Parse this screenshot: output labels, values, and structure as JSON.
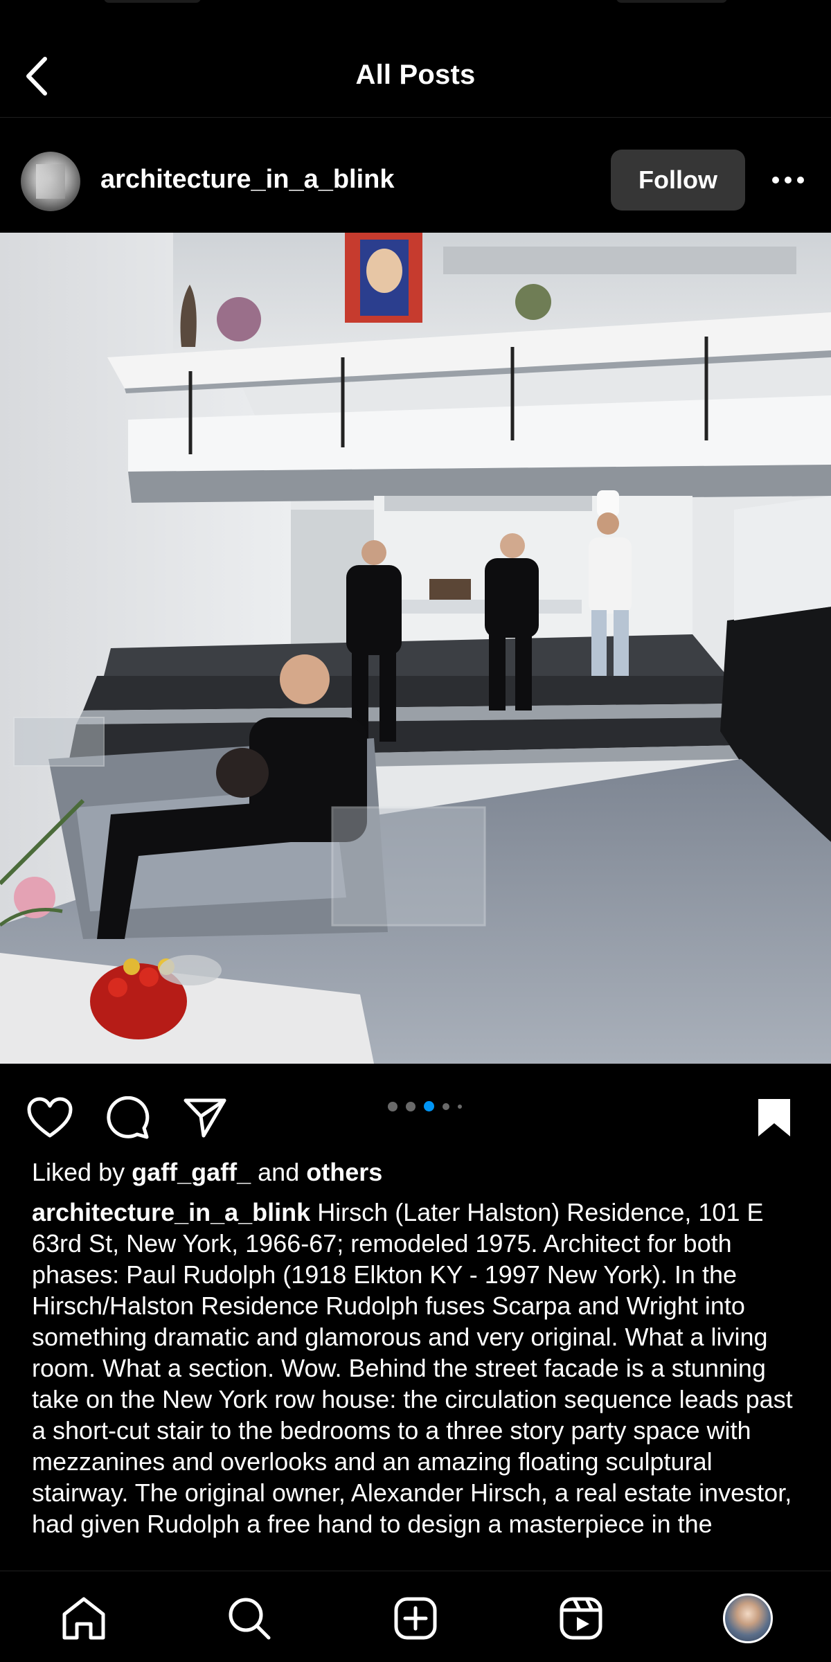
{
  "nav": {
    "title": "All Posts"
  },
  "post": {
    "username": "architecture_in_a_blink",
    "follow_label": "Follow",
    "likes": {
      "prefix": "Liked by",
      "user": "gaff_gaff_",
      "mid": "and",
      "others": "others"
    },
    "caption_user": "architecture_in_a_blink",
    "caption_text": "Hirsch (Later Halston) Residence, 101 E 63rd St, New York, 1966-67; remodeled 1975. Architect for both phases: Paul Rudolph (1918 Elkton KY - 1997 New York). In the Hirsch/Halston Residence Rudolph fuses Scarpa and Wright into something dramatic and glamorous and very original. What a living room. What a section. Wow. Behind the street facade is a stunning take on the New York row house: the circulation sequence leads past a short-cut stair to the bedrooms to a three story party space with mezzanines and overlooks and an amazing floating sculptural stairway. The original owner, Alexander Hirsch, a real estate investor, had given Rudolph a free hand to design a masterpiece in the",
    "carousel": {
      "count": 5,
      "active_index": 2
    }
  },
  "icons": {
    "back": "chevron-left-icon",
    "more": "ellipsis-icon",
    "like": "heart-icon",
    "comment": "comment-icon",
    "share": "send-icon",
    "save": "bookmark-icon",
    "home": "home-icon",
    "search": "search-icon",
    "create": "plus-square-icon",
    "reels": "reels-icon",
    "profile": "profile-avatar"
  },
  "colors": {
    "background": "#000000",
    "follow_bg": "#363636",
    "active_dot": "#0095f6",
    "text": "#ffffff"
  }
}
